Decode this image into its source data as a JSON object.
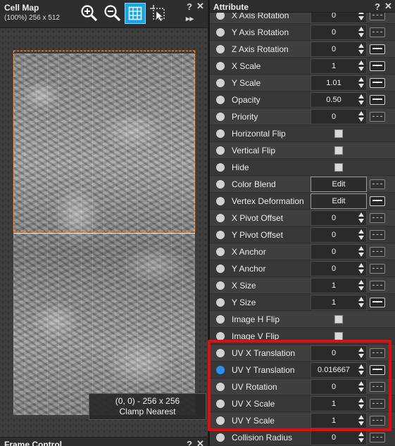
{
  "cell_map": {
    "title": "Cell Map",
    "subtitle": "(100%) 256 x 512",
    "help": "?",
    "close": "✕",
    "expand": "▸▸",
    "info_line1": "(0, 0) - 256 x 256",
    "info_line2": "Clamp  Nearest",
    "active_tool": "grid-icon",
    "accent": "#1aa6e6",
    "selection_color": "#ff9a1a"
  },
  "frame_control": {
    "title": "Frame Control",
    "help": "?",
    "close": "✕"
  },
  "attribute": {
    "title": "Attribute",
    "help": "?",
    "close": "✕",
    "rows": [
      {
        "label": "X Axis Rotation",
        "kind": "value",
        "value": "0",
        "curve": "dashed"
      },
      {
        "label": "Y Axis Rotation",
        "kind": "value",
        "value": "0",
        "curve": "dashed"
      },
      {
        "label": "Z Axis Rotation",
        "kind": "value",
        "value": "0",
        "curve": "solid"
      },
      {
        "label": "X Scale",
        "kind": "value",
        "value": "1",
        "curve": "solid"
      },
      {
        "label": "Y Scale",
        "kind": "value",
        "value": "1.01",
        "curve": "solid"
      },
      {
        "label": "Opacity",
        "kind": "value",
        "value": "0.50",
        "curve": "solid"
      },
      {
        "label": "Priority",
        "kind": "value",
        "value": "0",
        "curve": "dashed"
      },
      {
        "label": "Horizontal Flip",
        "kind": "check"
      },
      {
        "label": "Vertical Flip",
        "kind": "check"
      },
      {
        "label": "Hide",
        "kind": "check"
      },
      {
        "label": "Color Blend",
        "kind": "edit",
        "value": "Edit",
        "curve": "dashed"
      },
      {
        "label": "Vertex Deformation",
        "kind": "edit",
        "value": "Edit",
        "curve": "solid"
      },
      {
        "label": "X Pivot Offset",
        "kind": "value",
        "value": "0",
        "curve": "dashed"
      },
      {
        "label": "Y Pivot Offset",
        "kind": "value",
        "value": "0",
        "curve": "dashed"
      },
      {
        "label": "X Anchor",
        "kind": "value",
        "value": "0",
        "curve": "dashed"
      },
      {
        "label": "Y Anchor",
        "kind": "value",
        "value": "0",
        "curve": "dashed"
      },
      {
        "label": "X Size",
        "kind": "value",
        "value": "1",
        "curve": "dashed"
      },
      {
        "label": "Y Size",
        "kind": "value",
        "value": "1",
        "curve": "solid"
      },
      {
        "label": "Image H Flip",
        "kind": "check"
      },
      {
        "label": "Image V Flip",
        "kind": "check"
      },
      {
        "label": "UV X Translation",
        "kind": "value",
        "value": "0",
        "curve": "dashed"
      },
      {
        "label": "UV Y Translation",
        "kind": "value",
        "value": "0.016667",
        "curve": "solid",
        "active": true
      },
      {
        "label": "UV Rotation",
        "kind": "value",
        "value": "0",
        "curve": "dashed"
      },
      {
        "label": "UV X Scale",
        "kind": "value",
        "value": "1",
        "curve": "dashed"
      },
      {
        "label": "UV Y Scale",
        "kind": "value",
        "value": "1",
        "curve": "dashed"
      },
      {
        "label": "Collision Radius",
        "kind": "value",
        "value": "0",
        "curve": "dashed"
      }
    ],
    "highlight_color": "#e00f0f"
  }
}
